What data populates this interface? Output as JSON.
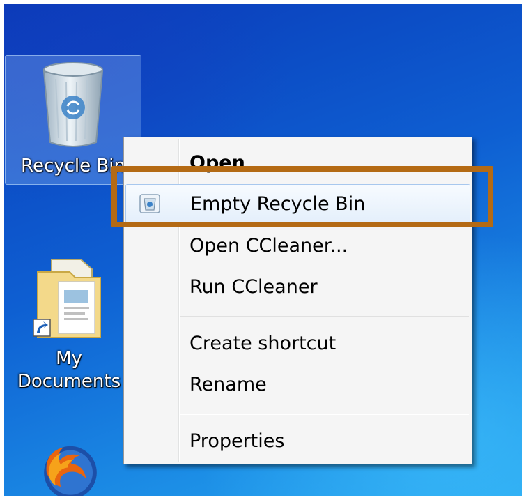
{
  "desktop": {
    "icons": [
      {
        "label": "Recycle Bin",
        "icon": "recycle-bin-icon",
        "selected": true
      },
      {
        "label_line1": "My",
        "label_line2": "Documents",
        "icon": "my-documents-icon"
      },
      {
        "icon": "firefox-icon"
      }
    ]
  },
  "context_menu": {
    "items": [
      {
        "label": "Open"
      },
      {
        "label": "Empty Recycle Bin",
        "icon": "recycle-bin-small-icon",
        "highlighted": true
      },
      {
        "label": "Open CCleaner..."
      },
      {
        "label": "Run CCleaner"
      },
      {
        "label": "Create shortcut"
      },
      {
        "label": "Rename"
      },
      {
        "label": "Properties"
      }
    ]
  },
  "annotation": {
    "color": "#b46a14"
  }
}
